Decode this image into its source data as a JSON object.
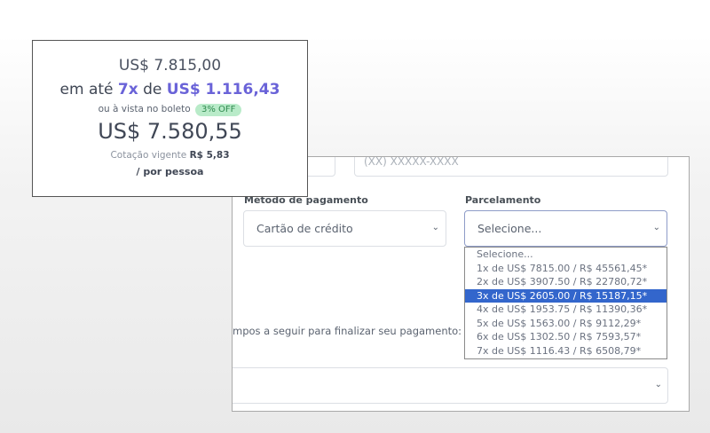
{
  "form": {
    "phone_placeholder": "(XX) XXXXX-XXXX",
    "payment_method_label": "Método de pagamento",
    "payment_method_value": "Cartão de crédito",
    "installments_label": "Parcelamento",
    "installments_value": "Selecione...",
    "instruction_text": "mpos a seguir para finalizar seu pagamento:"
  },
  "dropdown": {
    "options": [
      "Selecione...",
      "1x de US$ 7815.00 / R$ 45561,45*",
      "2x de US$ 3907.50 / R$ 22780,72*",
      "3x de US$ 2605.00 / R$ 15187,15*",
      "4x de US$ 1953.75 / R$ 11390,36*",
      "5x de US$ 1563.00 / R$ 9112,29*",
      "6x de US$ 1302.50 / R$ 7593,57*",
      "7x de US$ 1116.43 / R$ 6508,79*"
    ],
    "highlighted_index": 3
  },
  "price_card": {
    "original_price": "US$ 7.815,00",
    "installment_prefix": "em até",
    "installment_count": "7x",
    "installment_mid": "de",
    "installment_amount": "US$ 1.116,43",
    "boleto_text": "ou à vista no boleto",
    "discount_badge": "3% OFF",
    "cash_price": "US$ 7.580,55",
    "rate_label": "Cotação vigente",
    "rate_value": "R$ 5,83",
    "per_person": "/ por pessoa"
  },
  "icons": {
    "select_chevron": "chevron-down-icon"
  },
  "colors": {
    "accent": "#6a63d8",
    "highlight": "#3366cc",
    "badge_bg": "#b9ebc9",
    "badge_text": "#2f8a4f"
  }
}
